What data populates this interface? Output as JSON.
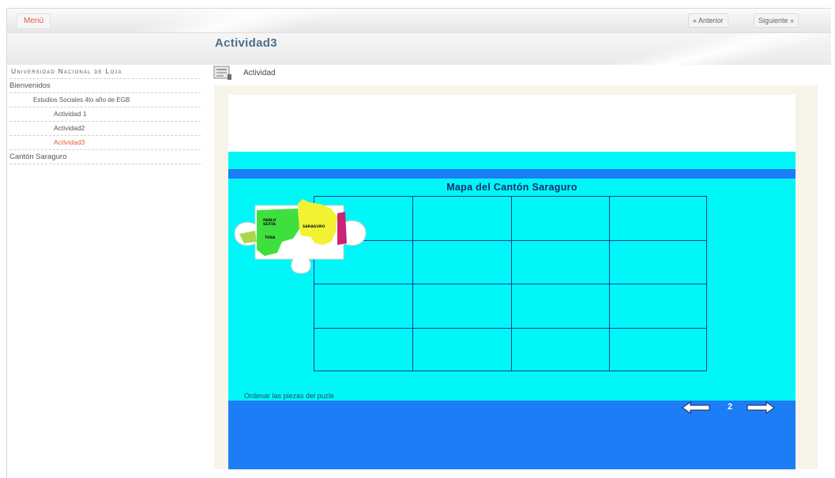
{
  "topbar": {
    "menu_label": "Menú",
    "prev_label": "« Anterior",
    "next_label": "Siguiente »"
  },
  "page": {
    "title": "Actividad3"
  },
  "sidebar": {
    "site_title": "Universidad Nacional de Loja",
    "items": [
      {
        "label": "Bienvenidos",
        "level": 0
      },
      {
        "label": "Estudios Sociales 4to año de EGB",
        "level": 1
      },
      {
        "label": "Actividad 1",
        "level": 2
      },
      {
        "label": "Actividad2",
        "level": 2
      },
      {
        "label": "Actividad3",
        "level": 2,
        "active": true
      },
      {
        "label": "Cantón Saraguro",
        "level": 0
      }
    ]
  },
  "content": {
    "section_label": "Actividad",
    "icon": "document-icon"
  },
  "activity": {
    "puzzle_title": "Mapa del Cantón Saraguro",
    "grid_rows": 4,
    "grid_cols": 4,
    "instruction": "Ordenar las piezas del puzle",
    "page_number": "2",
    "piece_labels": [
      "PABLO SEXTA",
      "SARAGURO",
      "TENA"
    ],
    "colors": {
      "cyan": "#00f7f7",
      "blue": "#1c7df7",
      "grid_line": "#1a3a9a",
      "accent": "#e05b3c"
    }
  }
}
